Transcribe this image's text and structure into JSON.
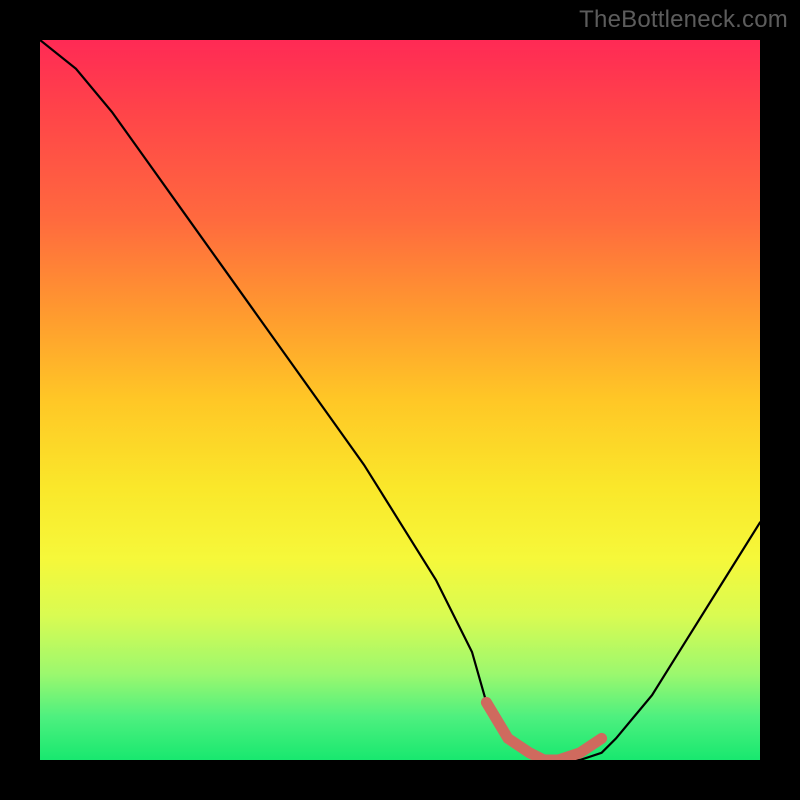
{
  "watermark": "TheBottleneck.com",
  "chart_data": {
    "type": "line",
    "title": "",
    "xlabel": "",
    "ylabel": "",
    "ylim": [
      0,
      100
    ],
    "x": [
      0,
      5,
      10,
      15,
      20,
      25,
      30,
      35,
      40,
      45,
      50,
      55,
      60,
      62,
      65,
      68,
      70,
      72,
      75,
      78,
      80,
      85,
      90,
      95,
      100
    ],
    "series": [
      {
        "name": "bottleneck-curve",
        "values": [
          100,
          96,
          90,
          83,
          76,
          69,
          62,
          55,
          48,
          41,
          33,
          25,
          15,
          8,
          3,
          1,
          0,
          0,
          0,
          1,
          3,
          9,
          17,
          25,
          33
        ]
      }
    ],
    "highlight": {
      "name": "optimal-zone",
      "x": [
        62,
        65,
        68,
        70,
        72,
        75,
        78
      ],
      "values": [
        8,
        3,
        1,
        0,
        0,
        1,
        3
      ],
      "color": "#cf6a5e"
    },
    "background_gradient": {
      "top": "#ff2a55",
      "mid": "#fae72a",
      "bottom": "#18e86f"
    }
  }
}
